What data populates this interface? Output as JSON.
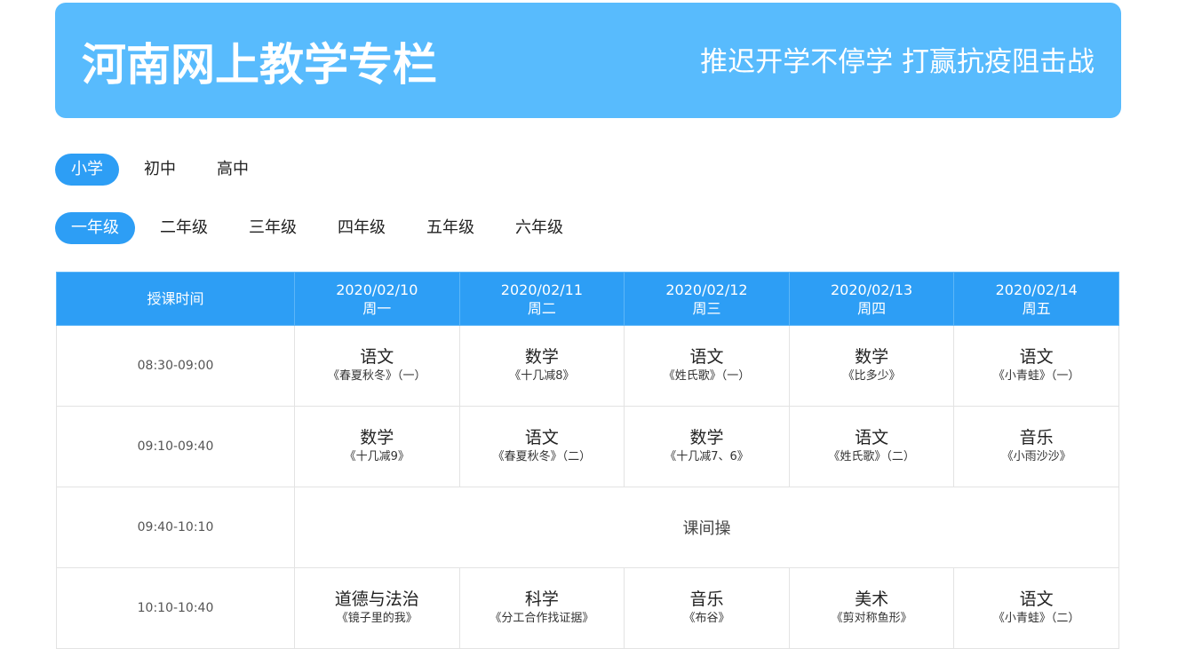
{
  "banner": {
    "title": "河南网上教学专栏",
    "slogan": "推迟开学不停学 打赢抗疫阻击战",
    "color": "#58bbfd"
  },
  "levels": [
    {
      "label": "小学",
      "active": true
    },
    {
      "label": "初中",
      "active": false
    },
    {
      "label": "高中",
      "active": false
    }
  ],
  "grades": [
    {
      "label": "一年级",
      "active": true
    },
    {
      "label": "二年级",
      "active": false
    },
    {
      "label": "三年级",
      "active": false
    },
    {
      "label": "四年级",
      "active": false
    },
    {
      "label": "五年级",
      "active": false
    },
    {
      "label": "六年级",
      "active": false
    }
  ],
  "schedule": {
    "time_header": "授课时间",
    "days": [
      {
        "date": "2020/02/10",
        "weekday": "周一"
      },
      {
        "date": "2020/02/11",
        "weekday": "周二"
      },
      {
        "date": "2020/02/12",
        "weekday": "周三"
      },
      {
        "date": "2020/02/13",
        "weekday": "周四"
      },
      {
        "date": "2020/02/14",
        "weekday": "周五"
      }
    ],
    "rows": [
      {
        "time": "08:30-09:00",
        "cells": [
          {
            "subject": "语文",
            "lesson": "《春夏秋冬》（一）"
          },
          {
            "subject": "数学",
            "lesson": "《十几减8》"
          },
          {
            "subject": "语文",
            "lesson": "《姓氏歌》（一）"
          },
          {
            "subject": "数学",
            "lesson": "《比多少》"
          },
          {
            "subject": "语文",
            "lesson": "《小青蛙》（一）"
          }
        ]
      },
      {
        "time": "09:10-09:40",
        "cells": [
          {
            "subject": "数学",
            "lesson": "《十几减9》"
          },
          {
            "subject": "语文",
            "lesson": "《春夏秋冬》（二）"
          },
          {
            "subject": "数学",
            "lesson": "《十几减7、6》"
          },
          {
            "subject": "语文",
            "lesson": "《姓氏歌》（二）"
          },
          {
            "subject": "音乐",
            "lesson": "《小雨沙沙》"
          }
        ]
      },
      {
        "time": "09:40-10:10",
        "break_label": "课间操"
      },
      {
        "time": "10:10-10:40",
        "cells": [
          {
            "subject": "道德与法治",
            "lesson": "《镜子里的我》"
          },
          {
            "subject": "科学",
            "lesson": "《分工合作找证据》"
          },
          {
            "subject": "音乐",
            "lesson": "《布谷》"
          },
          {
            "subject": "美术",
            "lesson": "《剪对称鱼形》"
          },
          {
            "subject": "语文",
            "lesson": "《小青蛙》（二）"
          }
        ]
      }
    ]
  },
  "accent_color": "#2d9ef5"
}
